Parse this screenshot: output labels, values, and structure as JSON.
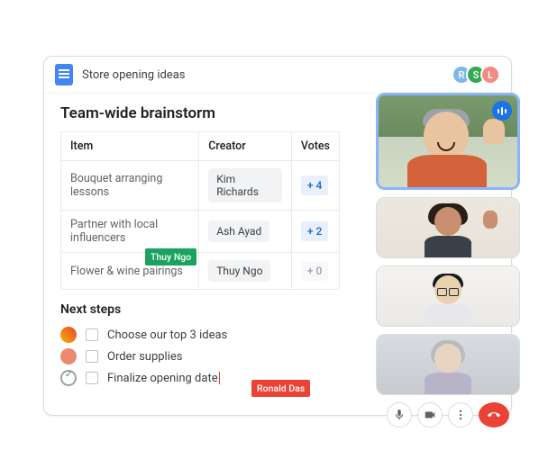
{
  "document": {
    "title": "Store opening ideas",
    "collaborators": [
      {
        "initial": "R",
        "color": "#7cb8e8"
      },
      {
        "initial": "S",
        "color": "#34a853"
      },
      {
        "initial": "L",
        "color": "#f28b82"
      }
    ]
  },
  "heading": "Team-wide brainstorm",
  "table": {
    "columns": [
      "Item",
      "Creator",
      "Votes"
    ],
    "rows": [
      {
        "item": "Bouquet arranging lessons",
        "creator": "Kim Richards",
        "votes": "+ 4",
        "active": true
      },
      {
        "item": "Partner with local influencers",
        "creator": "Ash Ayad",
        "votes": "+ 2",
        "active": true
      },
      {
        "item": "Flower & wine pairings",
        "creator": "Thuy Ngo",
        "votes": "+ 0",
        "active": false
      }
    ]
  },
  "cursor_tags": {
    "green": "Thuy Ngo",
    "red": "Ronald Das"
  },
  "next_steps": {
    "title": "Next steps",
    "items": [
      {
        "text": "Choose our top 3 ideas"
      },
      {
        "text": "Order supplies"
      },
      {
        "text": "Finalize opening date"
      }
    ]
  },
  "meet": {
    "controls": {
      "mic": "mic",
      "video": "video",
      "more": "more",
      "hangup": "hangup"
    }
  }
}
